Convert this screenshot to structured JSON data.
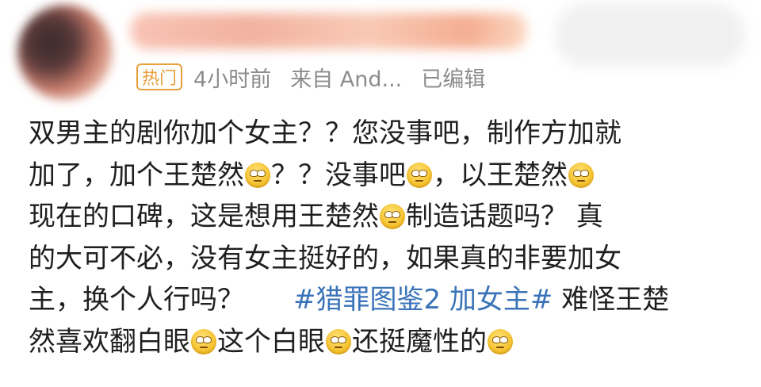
{
  "post": {
    "meta": {
      "badge": "热门",
      "time": "4小时前",
      "source": "来自 And...",
      "edited": "已编辑"
    },
    "lines": [
      [
        "双男主的剧你加个女主？？您没事吧，制作方加就"
      ],
      [
        "加了，加个王楚然",
        "[emoji]",
        "？？没事吧",
        "[emoji]",
        "，以王楚然",
        "[emoji]"
      ],
      [
        "现在的口碑，这是想用王楚然",
        "[emoji]",
        "制造话题吗？ 真"
      ],
      [
        "的大可不必，没有女主挺好的，如果真的非要加女"
      ],
      [
        "主，换个人行吗？   ",
        "#猎罪图鉴2 加女主#",
        " 难怪王楚"
      ],
      [
        "然喜欢翻白眼",
        "[emoji]",
        "这个白眼",
        "[emoji]",
        "还挺魔性的",
        "[emoji]"
      ]
    ],
    "text": {
      "l1": "双男主的剧你加个女主？？您没事吧，制作方加就",
      "l2a": "加了，加个王楚然",
      "l2b": "？？没事吧",
      "l2c": "，以王楚然",
      "l3a": "现在的口碑，这是想用王楚然",
      "l3b": "制造话题吗？ 真",
      "l4": "的大可不必，没有女主挺好的，如果真的非要加女",
      "l5a": "主，换个人行吗？",
      "hashtag": "#猎罪图鉴2 加女主#",
      "l5b": " 难怪王楚",
      "l6a": "然喜欢翻白眼",
      "l6b": "这个白眼",
      "l6c": "还挺魔性的"
    },
    "emoji_name": "eye-roll-emoji",
    "colors": {
      "hashtag": "#3a73b8",
      "badge": "#e8a13c",
      "meta": "#8c8c8c",
      "text": "#1f1f1f"
    }
  }
}
